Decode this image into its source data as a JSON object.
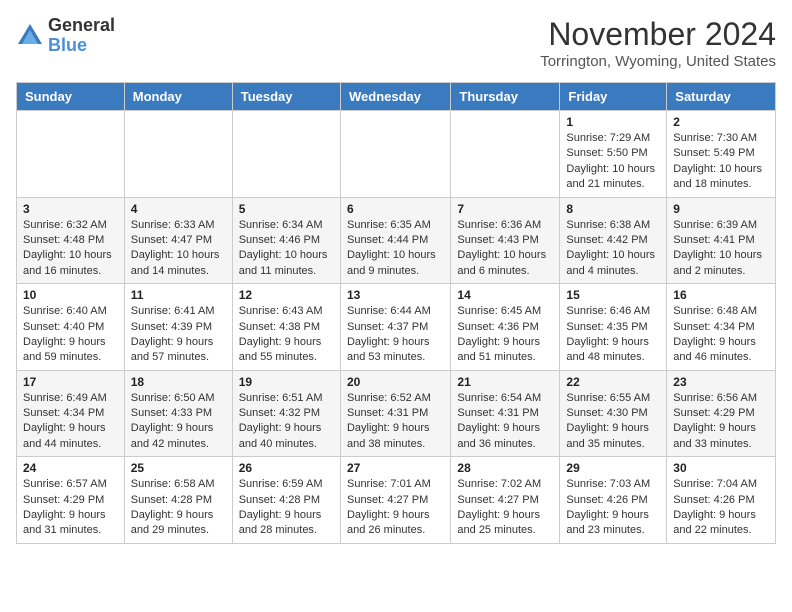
{
  "logo": {
    "general": "General",
    "blue": "Blue"
  },
  "title": "November 2024",
  "location": "Torrington, Wyoming, United States",
  "days_of_week": [
    "Sunday",
    "Monday",
    "Tuesday",
    "Wednesday",
    "Thursday",
    "Friday",
    "Saturday"
  ],
  "weeks": [
    [
      {
        "day": "",
        "info": ""
      },
      {
        "day": "",
        "info": ""
      },
      {
        "day": "",
        "info": ""
      },
      {
        "day": "",
        "info": ""
      },
      {
        "day": "",
        "info": ""
      },
      {
        "day": "1",
        "info": "Sunrise: 7:29 AM\nSunset: 5:50 PM\nDaylight: 10 hours and 21 minutes."
      },
      {
        "day": "2",
        "info": "Sunrise: 7:30 AM\nSunset: 5:49 PM\nDaylight: 10 hours and 18 minutes."
      }
    ],
    [
      {
        "day": "3",
        "info": "Sunrise: 6:32 AM\nSunset: 4:48 PM\nDaylight: 10 hours and 16 minutes."
      },
      {
        "day": "4",
        "info": "Sunrise: 6:33 AM\nSunset: 4:47 PM\nDaylight: 10 hours and 14 minutes."
      },
      {
        "day": "5",
        "info": "Sunrise: 6:34 AM\nSunset: 4:46 PM\nDaylight: 10 hours and 11 minutes."
      },
      {
        "day": "6",
        "info": "Sunrise: 6:35 AM\nSunset: 4:44 PM\nDaylight: 10 hours and 9 minutes."
      },
      {
        "day": "7",
        "info": "Sunrise: 6:36 AM\nSunset: 4:43 PM\nDaylight: 10 hours and 6 minutes."
      },
      {
        "day": "8",
        "info": "Sunrise: 6:38 AM\nSunset: 4:42 PM\nDaylight: 10 hours and 4 minutes."
      },
      {
        "day": "9",
        "info": "Sunrise: 6:39 AM\nSunset: 4:41 PM\nDaylight: 10 hours and 2 minutes."
      }
    ],
    [
      {
        "day": "10",
        "info": "Sunrise: 6:40 AM\nSunset: 4:40 PM\nDaylight: 9 hours and 59 minutes."
      },
      {
        "day": "11",
        "info": "Sunrise: 6:41 AM\nSunset: 4:39 PM\nDaylight: 9 hours and 57 minutes."
      },
      {
        "day": "12",
        "info": "Sunrise: 6:43 AM\nSunset: 4:38 PM\nDaylight: 9 hours and 55 minutes."
      },
      {
        "day": "13",
        "info": "Sunrise: 6:44 AM\nSunset: 4:37 PM\nDaylight: 9 hours and 53 minutes."
      },
      {
        "day": "14",
        "info": "Sunrise: 6:45 AM\nSunset: 4:36 PM\nDaylight: 9 hours and 51 minutes."
      },
      {
        "day": "15",
        "info": "Sunrise: 6:46 AM\nSunset: 4:35 PM\nDaylight: 9 hours and 48 minutes."
      },
      {
        "day": "16",
        "info": "Sunrise: 6:48 AM\nSunset: 4:34 PM\nDaylight: 9 hours and 46 minutes."
      }
    ],
    [
      {
        "day": "17",
        "info": "Sunrise: 6:49 AM\nSunset: 4:34 PM\nDaylight: 9 hours and 44 minutes."
      },
      {
        "day": "18",
        "info": "Sunrise: 6:50 AM\nSunset: 4:33 PM\nDaylight: 9 hours and 42 minutes."
      },
      {
        "day": "19",
        "info": "Sunrise: 6:51 AM\nSunset: 4:32 PM\nDaylight: 9 hours and 40 minutes."
      },
      {
        "day": "20",
        "info": "Sunrise: 6:52 AM\nSunset: 4:31 PM\nDaylight: 9 hours and 38 minutes."
      },
      {
        "day": "21",
        "info": "Sunrise: 6:54 AM\nSunset: 4:31 PM\nDaylight: 9 hours and 36 minutes."
      },
      {
        "day": "22",
        "info": "Sunrise: 6:55 AM\nSunset: 4:30 PM\nDaylight: 9 hours and 35 minutes."
      },
      {
        "day": "23",
        "info": "Sunrise: 6:56 AM\nSunset: 4:29 PM\nDaylight: 9 hours and 33 minutes."
      }
    ],
    [
      {
        "day": "24",
        "info": "Sunrise: 6:57 AM\nSunset: 4:29 PM\nDaylight: 9 hours and 31 minutes."
      },
      {
        "day": "25",
        "info": "Sunrise: 6:58 AM\nSunset: 4:28 PM\nDaylight: 9 hours and 29 minutes."
      },
      {
        "day": "26",
        "info": "Sunrise: 6:59 AM\nSunset: 4:28 PM\nDaylight: 9 hours and 28 minutes."
      },
      {
        "day": "27",
        "info": "Sunrise: 7:01 AM\nSunset: 4:27 PM\nDaylight: 9 hours and 26 minutes."
      },
      {
        "day": "28",
        "info": "Sunrise: 7:02 AM\nSunset: 4:27 PM\nDaylight: 9 hours and 25 minutes."
      },
      {
        "day": "29",
        "info": "Sunrise: 7:03 AM\nSunset: 4:26 PM\nDaylight: 9 hours and 23 minutes."
      },
      {
        "day": "30",
        "info": "Sunrise: 7:04 AM\nSunset: 4:26 PM\nDaylight: 9 hours and 22 minutes."
      }
    ]
  ]
}
